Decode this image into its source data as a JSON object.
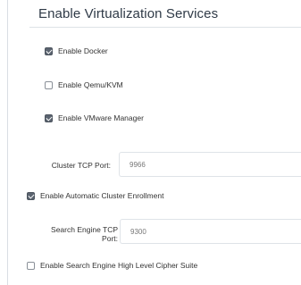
{
  "section": {
    "title": "Enable Virtualization Services"
  },
  "options": {
    "docker": {
      "label": "Enable Docker",
      "checked": true
    },
    "qemu": {
      "label": "Enable Qemu/KVM",
      "checked": false
    },
    "vmware": {
      "label": "Enable VMware Manager",
      "checked": true
    },
    "cluster_enrollment": {
      "label": "Enable Automatic Cluster Enrollment",
      "checked": true
    },
    "cipher_suite": {
      "label": "Enable Search Engine High Level Cipher Suite",
      "checked": false
    }
  },
  "fields": {
    "cluster_tcp_port": {
      "label": "Cluster TCP Port:",
      "value": "9966"
    },
    "search_engine_tcp_port": {
      "label_line1": "Search Engine TCP",
      "label_line2": "Port:",
      "value": "9300"
    }
  }
}
